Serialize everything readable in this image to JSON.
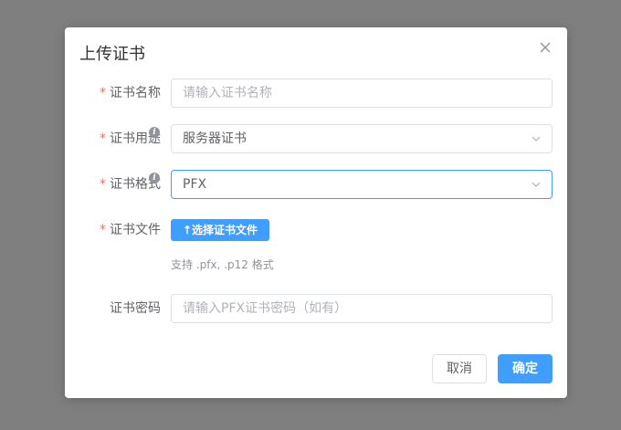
{
  "dialog": {
    "title": "上传证书",
    "close_icon": "close-icon"
  },
  "form": {
    "name": {
      "required_mark": "*",
      "label": "证书名称",
      "placeholder": "请输入证书名称",
      "value": ""
    },
    "usage": {
      "required_mark": "*",
      "label": "证书用途",
      "info_icon": "info-icon",
      "value": "服务器证书"
    },
    "format": {
      "required_mark": "*",
      "label": "证书格式",
      "info_icon": "info-icon",
      "value": "PFX"
    },
    "file": {
      "required_mark": "*",
      "label": "证书文件",
      "button_label": "选择证书文件",
      "hint": "支持 .pfx, .p12 格式"
    },
    "password": {
      "label": "证书密码",
      "placeholder": "请输入PFX证书密码（如有）",
      "value": ""
    }
  },
  "footer": {
    "cancel_label": "取消",
    "confirm_label": "确定"
  },
  "colors": {
    "primary": "#409eff",
    "required": "#f56c6c",
    "overlay": "#7f7f7f"
  }
}
